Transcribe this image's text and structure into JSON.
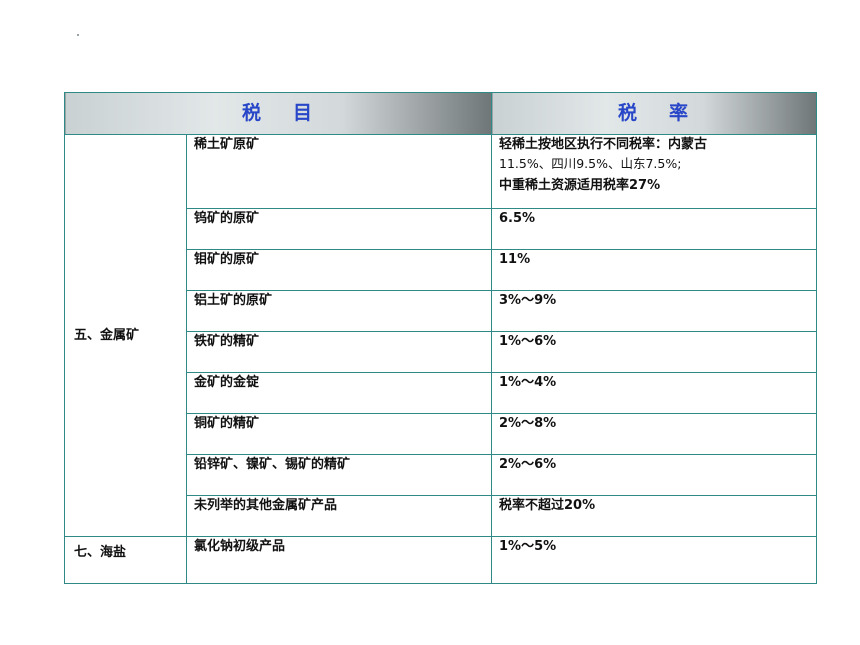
{
  "header": {
    "col1_part1": "税",
    "col1_part2": "目",
    "col2_part1": "税",
    "col2_part2": "率"
  },
  "categories": {
    "metal": "五、金属矿",
    "salt": "七、海盐"
  },
  "rows": [
    {
      "item": "稀土矿原矿",
      "rate_line1": "轻稀土按地区执行不同税率：内蒙古",
      "rate_line2": "11.5%、四川9.5%、山东7.5%;",
      "rate_line3": "中重稀土资源适用税率27%"
    },
    {
      "item": "钨矿的原矿",
      "rate": "6.5%"
    },
    {
      "item": "钼矿的原矿",
      "rate": "11%"
    },
    {
      "item": "铝土矿的原矿",
      "rate": "3%～9%"
    },
    {
      "item": "铁矿的精矿",
      "rate": "1%～6%"
    },
    {
      "item": "金矿的金锭",
      "rate": "1%～4%"
    },
    {
      "item": "铜矿的精矿",
      "rate": "2%～8%"
    },
    {
      "item": "铅锌矿、镍矿、锡矿的精矿",
      "rate": "2%～6%"
    },
    {
      "item": "未列举的其他金属矿产品",
      "rate": "税率不超过20%"
    },
    {
      "item": "氯化钠初级产品",
      "rate": "1%～5%"
    }
  ]
}
